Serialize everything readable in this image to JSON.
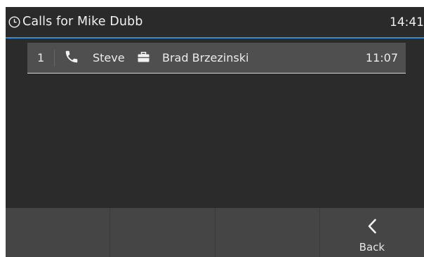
{
  "header": {
    "title": "Calls for Mike Dubb",
    "time": "14:41"
  },
  "calls": [
    {
      "index": "1",
      "caller": "Steve",
      "callee": "Brad Brzezinski",
      "time": "11:07"
    }
  ],
  "softkeys": {
    "back_label": "Back"
  },
  "colors": {
    "accent": "#2f8ecf",
    "background": "#2b2b2b",
    "row": "#4f4f4f",
    "softkey_bar": "#454545"
  }
}
